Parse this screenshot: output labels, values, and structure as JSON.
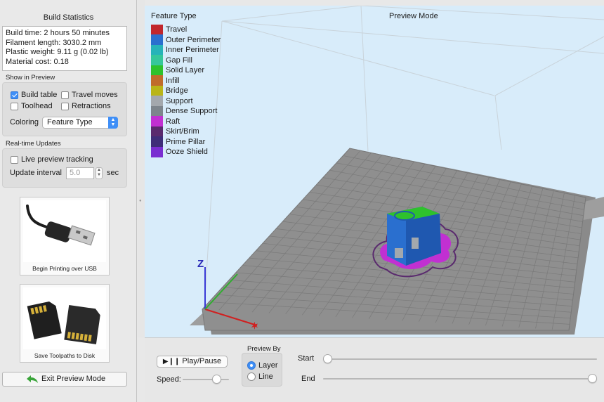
{
  "stats": {
    "title": "Build Statistics",
    "lines": [
      "Build time: 2 hours 50 minutes",
      "Filament length: 3030.2 mm",
      "Plastic weight: 9.11 g (0.02 lb)",
      "Material cost: 0.18"
    ]
  },
  "show_in_preview": {
    "label": "Show in Preview",
    "build_table": {
      "label": "Build table",
      "checked": true
    },
    "travel_moves": {
      "label": "Travel moves",
      "checked": false
    },
    "toolhead": {
      "label": "Toolhead",
      "checked": false
    },
    "retractions": {
      "label": "Retractions",
      "checked": false
    },
    "coloring_label": "Coloring",
    "coloring_value": "Feature Type"
  },
  "realtime": {
    "label": "Real-time Updates",
    "live_tracking": {
      "label": "Live preview tracking",
      "checked": false
    },
    "interval_label": "Update interval",
    "interval_value": "5.0",
    "interval_unit": "sec"
  },
  "actions": {
    "usb_label": "Begin Printing over USB",
    "sd_label": "Save Toolpaths to Disk",
    "exit_label": "Exit Preview Mode"
  },
  "viewport": {
    "legend_title": "Feature Type",
    "mode_label": "Preview Mode",
    "axis_z": "Z",
    "legend": [
      {
        "label": "Travel",
        "color": "#c1272d"
      },
      {
        "label": "Outer Perimeter",
        "color": "#2a6fcf"
      },
      {
        "label": "Inner Perimeter",
        "color": "#27b3b8"
      },
      {
        "label": "Gap Fill",
        "color": "#36c79a"
      },
      {
        "label": "Solid Layer",
        "color": "#2ec22c"
      },
      {
        "label": "Infill",
        "color": "#c06c2b"
      },
      {
        "label": "Bridge",
        "color": "#b9b518"
      },
      {
        "label": "Support",
        "color": "#a3a8ad"
      },
      {
        "label": "Dense Support",
        "color": "#7d858c"
      },
      {
        "label": "Raft",
        "color": "#c130d2"
      },
      {
        "label": "Skirt/Brim",
        "color": "#5a2a6e"
      },
      {
        "label": "Prime Pillar",
        "color": "#3f2d79"
      },
      {
        "label": "Ooze Shield",
        "color": "#7a2ed1"
      }
    ]
  },
  "controls": {
    "play_label": "Play/Pause",
    "speed_label": "Speed:",
    "speed_level": 0.8,
    "preview_by_label": "Preview By",
    "layer_label": "Layer",
    "line_label": "Line",
    "layer_selected": true,
    "start_label": "Start",
    "end_label": "End",
    "start_fraction": 0.0,
    "end_fraction": 1.0
  },
  "colors": {
    "accent": "#3f8ff7",
    "viewport_bg": "#d8ecfa",
    "bed": "#8d8d8d"
  }
}
